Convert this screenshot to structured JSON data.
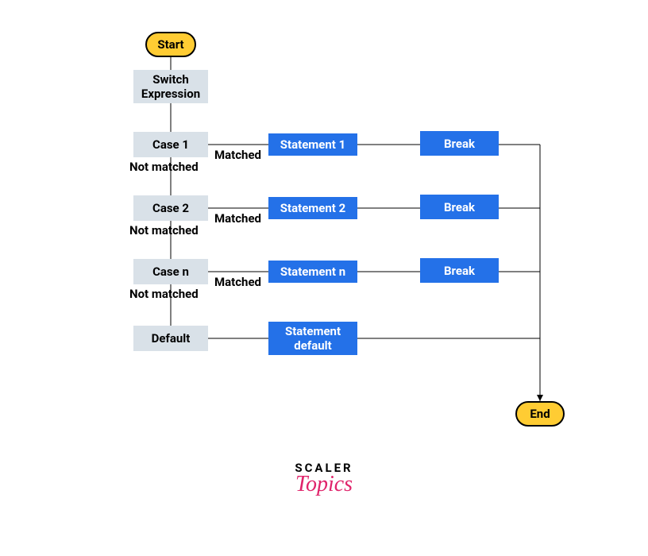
{
  "terminal": {
    "start": "Start",
    "end": "End"
  },
  "switch_expr": "Switch Expression",
  "cases": [
    {
      "label": "Case 1",
      "statement": "Statement 1",
      "break": "Break",
      "matched": "Matched",
      "notmatched": "Not matched"
    },
    {
      "label": "Case 2",
      "statement": "Statement 2",
      "break": "Break",
      "matched": "Matched",
      "notmatched": "Not matched"
    },
    {
      "label": "Case n",
      "statement": "Statement n",
      "break": "Break",
      "matched": "Matched",
      "notmatched": "Not matched"
    }
  ],
  "default": {
    "label": "Default",
    "statement": "Statement default"
  },
  "brand": {
    "top": "SCALER",
    "bottom": "Topics"
  },
  "colors": {
    "terminal": "#FFCC33",
    "process": "#D9E1E8",
    "action": "#2471E8",
    "brand_pink": "#E0246B"
  }
}
